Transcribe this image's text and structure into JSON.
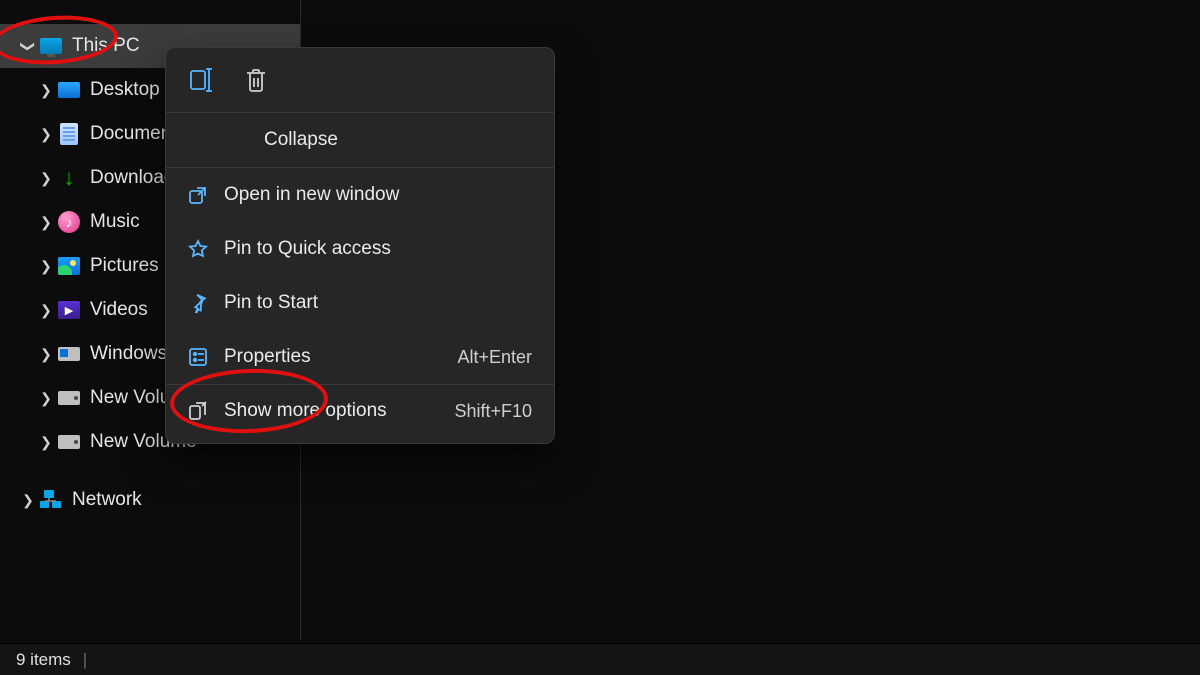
{
  "sidebar": {
    "root": {
      "label": "This PC"
    },
    "children": [
      {
        "label": "Desktop"
      },
      {
        "label": "Documents"
      },
      {
        "label": "Downloads"
      },
      {
        "label": "Music"
      },
      {
        "label": "Pictures"
      },
      {
        "label": "Videos"
      },
      {
        "label": "Windows (C"
      },
      {
        "label": "New Volume"
      },
      {
        "label": "New Volume"
      }
    ],
    "root2": {
      "label": "Network"
    }
  },
  "context_menu": {
    "collapse": "Collapse",
    "open_new_window": "Open in new window",
    "pin_quick_access": "Pin to Quick access",
    "pin_start": "Pin to Start",
    "properties": "Properties",
    "properties_kbd": "Alt+Enter",
    "show_more": "Show more options",
    "show_more_kbd": "Shift+F10"
  },
  "statusbar": {
    "items": "9 items"
  }
}
